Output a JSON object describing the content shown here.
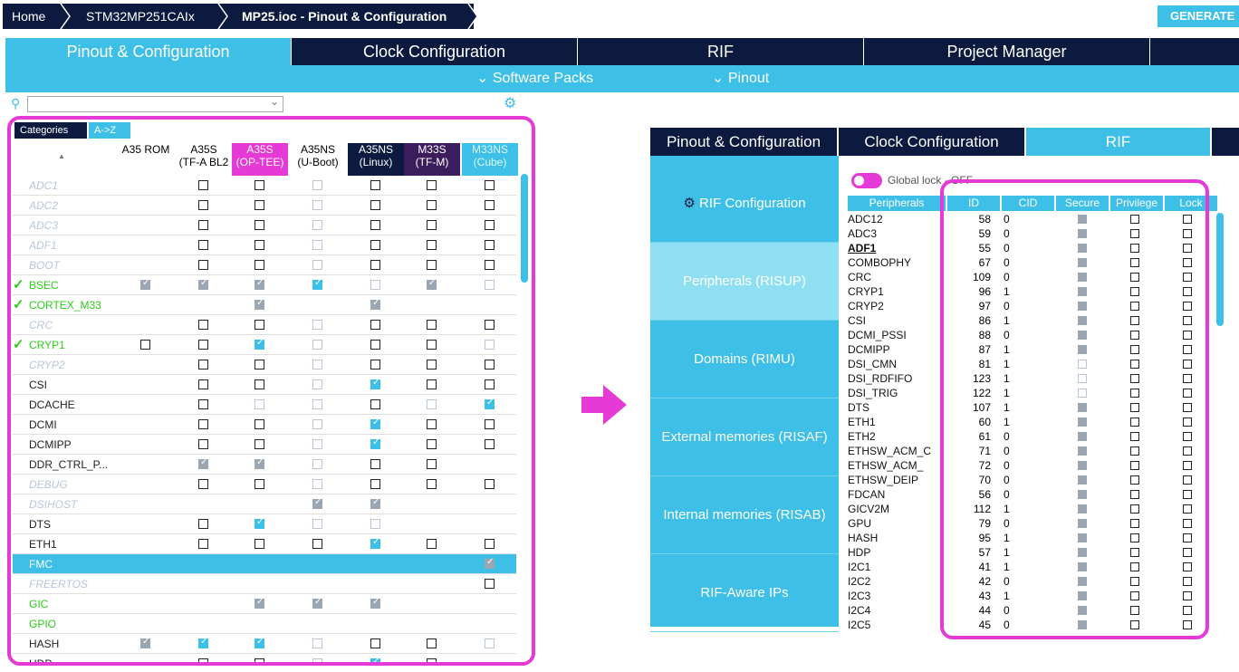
{
  "breadcrumb": [
    "Home",
    "STM32MP251CAIx",
    "MP25.ioc - Pinout & Configuration"
  ],
  "generate_label": "GENERATE",
  "main_tabs": [
    "Pinout & Configuration",
    "Clock Configuration",
    "RIF",
    "Project Manager"
  ],
  "subbar": [
    "Software Packs",
    "Pinout"
  ],
  "left": {
    "tabs": [
      "Categories",
      "A->Z"
    ],
    "headers": [
      "A35 ROM",
      "A35S\n(TF-A BL2",
      "A35S\n(OP-TEE)",
      "A35NS\n(U-Boot)",
      "A35NS\n(Linux)",
      "M33S\n(TF-M)",
      "M33NS\n(Cube)"
    ],
    "rows": [
      {
        "name": "ADC1",
        "style": "dim",
        "cells": [
          "",
          "u",
          "u",
          "g",
          "u",
          "u",
          "u"
        ]
      },
      {
        "name": "ADC2",
        "style": "dim",
        "cells": [
          "",
          "u",
          "u",
          "g",
          "u",
          "u",
          "u"
        ]
      },
      {
        "name": "ADC3",
        "style": "dim",
        "cells": [
          "",
          "u",
          "u",
          "g",
          "u",
          "u",
          "u"
        ]
      },
      {
        "name": "ADF1",
        "style": "dim",
        "cells": [
          "",
          "u",
          "u",
          "g",
          "u",
          "u",
          "u"
        ]
      },
      {
        "name": "BOOT",
        "style": "dim",
        "cells": [
          "",
          "u",
          "u",
          "g",
          "u",
          "u",
          "u"
        ]
      },
      {
        "name": "BSEC",
        "style": "green",
        "check": true,
        "cells": [
          "c",
          "c",
          "c",
          "b",
          "g",
          "c",
          "g"
        ]
      },
      {
        "name": "CORTEX_M33",
        "style": "green",
        "check": true,
        "cells": [
          "",
          "",
          "c",
          "",
          "c",
          "",
          ""
        ]
      },
      {
        "name": "CRC",
        "style": "dim",
        "cells": [
          "",
          "u",
          "u",
          "g",
          "u",
          "u",
          "u"
        ]
      },
      {
        "name": "CRYP1",
        "style": "green",
        "check": true,
        "cells": [
          "u",
          "u",
          "b",
          "g",
          "u",
          "u",
          "g"
        ]
      },
      {
        "name": "CRYP2",
        "style": "dim",
        "cells": [
          "",
          "u",
          "u",
          "g",
          "u",
          "u",
          "u"
        ]
      },
      {
        "name": "CSI",
        "style": "",
        "cells": [
          "",
          "u",
          "u",
          "g",
          "b",
          "u",
          "u"
        ]
      },
      {
        "name": "DCACHE",
        "style": "",
        "cells": [
          "",
          "u",
          "g",
          "g",
          "u",
          "g",
          "b"
        ]
      },
      {
        "name": "DCMI",
        "style": "",
        "cells": [
          "",
          "u",
          "u",
          "g",
          "b",
          "u",
          "u"
        ]
      },
      {
        "name": "DCMIPP",
        "style": "",
        "cells": [
          "",
          "u",
          "u",
          "g",
          "b",
          "u",
          "u"
        ]
      },
      {
        "name": "DDR_CTRL_P...",
        "style": "",
        "cells": [
          "",
          "c",
          "c",
          "g",
          "u",
          "u",
          ""
        ]
      },
      {
        "name": "DEBUG",
        "style": "dim",
        "cells": [
          "",
          "u",
          "u",
          "g",
          "u",
          "u",
          "u"
        ]
      },
      {
        "name": "DSIHOST",
        "style": "dim",
        "cells": [
          "",
          "",
          "",
          "c",
          "c",
          "",
          ""
        ]
      },
      {
        "name": "DTS",
        "style": "",
        "cells": [
          "",
          "u",
          "b",
          "g",
          "g",
          "",
          ""
        ]
      },
      {
        "name": "ETH1",
        "style": "",
        "cells": [
          "",
          "u",
          "u",
          "u",
          "b",
          "u",
          "u"
        ]
      },
      {
        "name": "FMC",
        "style": "white",
        "selected": true,
        "cells": [
          "",
          "",
          "",
          "",
          "",
          "",
          "c"
        ]
      },
      {
        "name": "FREERTOS",
        "style": "dim",
        "cells": [
          "",
          "",
          "",
          "",
          "",
          "",
          "u"
        ]
      },
      {
        "name": "GIC",
        "style": "green",
        "cells": [
          "",
          "",
          "c",
          "c",
          "c",
          "",
          ""
        ]
      },
      {
        "name": "GPIO",
        "style": "green",
        "cells": [
          "",
          "",
          "",
          "",
          "",
          "",
          ""
        ]
      },
      {
        "name": "HASH",
        "style": "",
        "cells": [
          "c",
          "b",
          "b",
          "g",
          "u",
          "u",
          "g"
        ]
      },
      {
        "name": "HDP",
        "style": "",
        "cells": [
          "",
          "u",
          "u",
          "g",
          "b",
          "u",
          ""
        ]
      }
    ]
  },
  "right": {
    "tabs": [
      "Pinout & Configuration",
      "Clock Configuration",
      "RIF"
    ],
    "sidebar": [
      "RIF Configuration",
      "Peripherals (RISUP)",
      "Domains (RIMU)",
      "External memories (RISAF)",
      "Internal memories (RISAB)",
      "RIF-Aware IPs"
    ],
    "global_lock": "Global lock - OFF",
    "headers": [
      "Peripherals",
      "ID",
      "CID",
      "Secure",
      "Privilege",
      "Lock"
    ],
    "rows": [
      {
        "name": "ADC12",
        "id": "58",
        "cid": "0",
        "s": "c"
      },
      {
        "name": "ADC3",
        "id": "59",
        "cid": "0",
        "s": "c"
      },
      {
        "name": "ADF1",
        "id": "55",
        "cid": "0",
        "s": "c"
      },
      {
        "name": "COMBOPHY",
        "id": "67",
        "cid": "0",
        "s": "c"
      },
      {
        "name": "CRC",
        "id": "109",
        "cid": "0",
        "s": "c"
      },
      {
        "name": "CRYP1",
        "id": "96",
        "cid": "1",
        "s": "c"
      },
      {
        "name": "CRYP2",
        "id": "97",
        "cid": "0",
        "s": "c"
      },
      {
        "name": "CSI",
        "id": "86",
        "cid": "1",
        "s": "c"
      },
      {
        "name": "DCMI_PSSI",
        "id": "88",
        "cid": "0",
        "s": "c"
      },
      {
        "name": "DCMIPP",
        "id": "87",
        "cid": "1",
        "s": "c"
      },
      {
        "name": "DSI_CMN",
        "id": "81",
        "cid": "1",
        "s": "g"
      },
      {
        "name": "DSI_RDFIFO",
        "id": "123",
        "cid": "1",
        "s": "g"
      },
      {
        "name": "DSI_TRIG",
        "id": "122",
        "cid": "1",
        "s": "g"
      },
      {
        "name": "DTS",
        "id": "107",
        "cid": "1",
        "s": "c"
      },
      {
        "name": "ETH1",
        "id": "60",
        "cid": "1",
        "s": "c"
      },
      {
        "name": "ETH2",
        "id": "61",
        "cid": "0",
        "s": "c"
      },
      {
        "name": "ETHSW_ACM_C",
        "id": "71",
        "cid": "0",
        "s": "c"
      },
      {
        "name": "ETHSW_ACM_",
        "id": "72",
        "cid": "0",
        "s": "c"
      },
      {
        "name": "ETHSW_DEIP",
        "id": "70",
        "cid": "0",
        "s": "c"
      },
      {
        "name": "FDCAN",
        "id": "56",
        "cid": "0",
        "s": "c"
      },
      {
        "name": "GICV2M",
        "id": "112",
        "cid": "1",
        "s": "c"
      },
      {
        "name": "GPU",
        "id": "79",
        "cid": "0",
        "s": "c"
      },
      {
        "name": "HASH",
        "id": "95",
        "cid": "1",
        "s": "c"
      },
      {
        "name": "HDP",
        "id": "57",
        "cid": "1",
        "s": "c"
      },
      {
        "name": "I2C1",
        "id": "41",
        "cid": "1",
        "s": "c"
      },
      {
        "name": "I2C2",
        "id": "42",
        "cid": "0",
        "s": "c"
      },
      {
        "name": "I2C3",
        "id": "43",
        "cid": "1",
        "s": "c"
      },
      {
        "name": "I2C4",
        "id": "44",
        "cid": "0",
        "s": "c"
      },
      {
        "name": "I2C5",
        "id": "45",
        "cid": "0",
        "s": "c"
      }
    ]
  },
  "colors": {
    "dark": "#0b1a3e",
    "accent": "#3dbfe8",
    "highlight": "#e63ad6",
    "active_green": "#2ecc1a"
  }
}
